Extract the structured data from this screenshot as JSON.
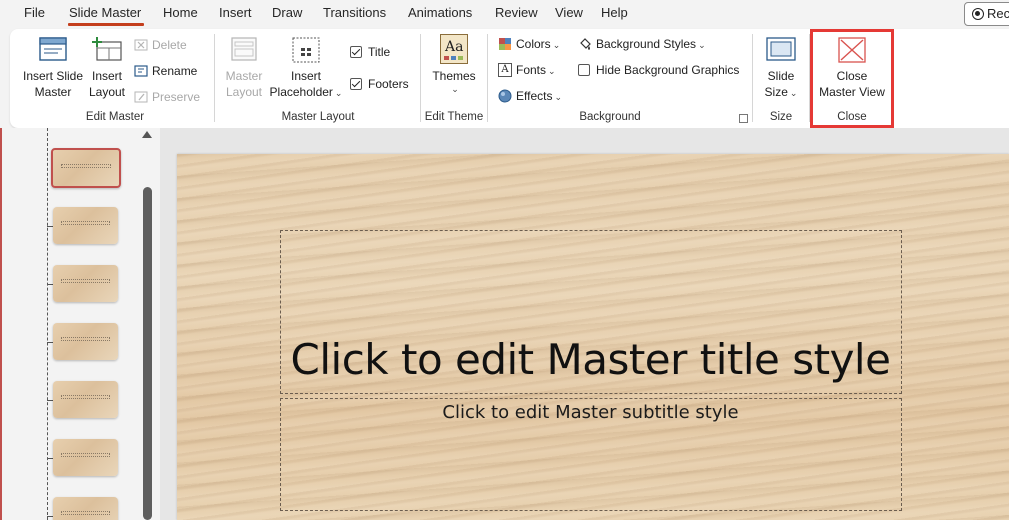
{
  "menu": {
    "items": [
      "File",
      "Slide Master",
      "Home",
      "Insert",
      "Draw",
      "Transitions",
      "Animations",
      "Review",
      "View",
      "Help"
    ],
    "active": "Slide Master",
    "record_label": "Rec"
  },
  "ribbon": {
    "edit_master": {
      "group_label": "Edit Master",
      "insert_slide_master": [
        "Insert Slide",
        "Master"
      ],
      "insert_layout": [
        "Insert",
        "Layout"
      ],
      "delete": "Delete",
      "rename": "Rename",
      "preserve": "Preserve"
    },
    "master_layout": {
      "group_label": "Master Layout",
      "master_layout": [
        "Master",
        "Layout"
      ],
      "insert_placeholder": [
        "Insert",
        "Placeholder"
      ],
      "title_checkbox": {
        "label": "Title",
        "checked": true
      },
      "footers_checkbox": {
        "label": "Footers",
        "checked": true
      }
    },
    "edit_theme": {
      "group_label": "Edit Theme",
      "themes": "Themes",
      "themes_icon_text": "Aa"
    },
    "background": {
      "group_label": "Background",
      "colors": "Colors",
      "fonts": "Fonts",
      "fonts_icon_text": "A",
      "effects": "Effects",
      "background_styles": "Background Styles",
      "hide_background_graphics": {
        "label": "Hide Background Graphics",
        "checked": false
      }
    },
    "size": {
      "group_label": "Size",
      "slide_size": [
        "Slide",
        "Size"
      ]
    },
    "close": {
      "group_label": "Close",
      "close_master_view": [
        "Close",
        "Master View"
      ],
      "highlight_color": "#e53935"
    }
  },
  "slide": {
    "title": "Click to edit Master title style",
    "subtitle": "Click to edit Master subtitle style"
  },
  "colors": {
    "accent": "#c43e1c",
    "selected_thumb_border": "#c0504d"
  }
}
